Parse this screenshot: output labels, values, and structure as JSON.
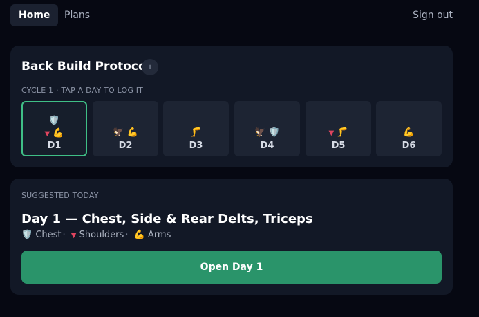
{
  "nav": {
    "tabs": [
      {
        "label": "Home",
        "active": true
      },
      {
        "label": "Plans",
        "active": false
      }
    ],
    "sign_out": "Sign out"
  },
  "protocol": {
    "title": "Back Build Protocol",
    "info_label": "i",
    "cycle_caption": "CYCLE 1 · TAP A DAY TO LOG IT",
    "days": [
      {
        "label": "D1",
        "icons_top": "🛡️",
        "icons_bottom": "▾ 💪",
        "selected": true
      },
      {
        "label": "D2",
        "icons_top": "",
        "icons_bottom": "🦅 💪",
        "selected": false
      },
      {
        "label": "D3",
        "icons_top": "",
        "icons_bottom": "🦵",
        "selected": false
      },
      {
        "label": "D4",
        "icons_top": "",
        "icons_bottom": "🦅 🛡️",
        "selected": false
      },
      {
        "label": "D5",
        "icons_top": "",
        "icons_bottom": "▾ 🦵",
        "selected": false
      },
      {
        "label": "D6",
        "icons_top": "",
        "icons_bottom": "💪",
        "selected": false
      }
    ]
  },
  "suggestion": {
    "caption": "SUGGESTED TODAY",
    "heading": "Day 1 — Chest, Side & Rear Delts, Triceps",
    "muscles": [
      {
        "icon": "🛡️",
        "label": "Chest"
      },
      {
        "icon": "▾",
        "label": "Shoulders"
      },
      {
        "icon": "💪",
        "label": "Arms"
      }
    ],
    "separator": "·",
    "button_label": "Open Day 1"
  },
  "colors": {
    "background": "#060812",
    "card": "#121826",
    "day_tile": "#1d2433",
    "accent_green": "#2a946a",
    "selected_border": "#3fbf86"
  }
}
